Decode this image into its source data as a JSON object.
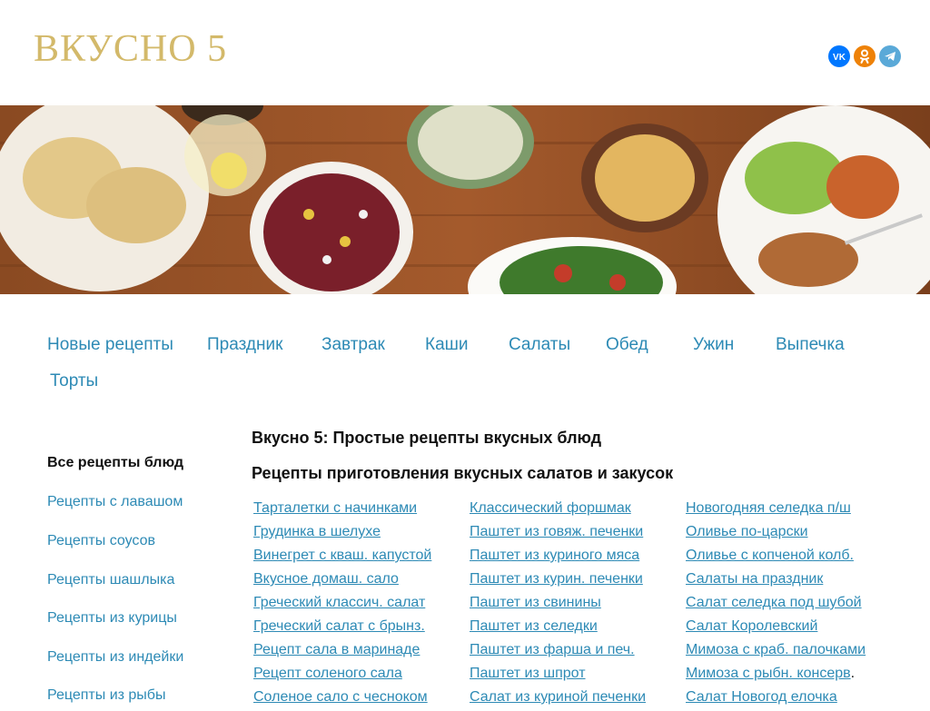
{
  "header": {
    "logo": "ВКУСНО 5",
    "social": [
      "vk-icon",
      "ok-icon",
      "telegram-icon"
    ]
  },
  "banner": {
    "image": "food-banner-photo"
  },
  "menu": [
    "Новые рецепты",
    "Праздник",
    "Завтрак",
    "Каши",
    "Салаты",
    "Обед",
    "Ужин",
    "Выпечка",
    "Торты"
  ],
  "sidebar": {
    "title": "Все рецепты блюд",
    "items": [
      "Рецепты с лавашом",
      "Рецепты соусов",
      "Рецепты шашлыка",
      "Рецепты из курицы",
      "Рецепты из индейки",
      "Рецепты из рыбы"
    ]
  },
  "main": {
    "title": "Вкусно 5: Простые рецепты вкусных блюд",
    "subtitle": "Рецепты приготовления вкусных салатов и закусок",
    "columns": [
      [
        "Тарталетки с начинками",
        "Грудинка в шелухе",
        "Винегрет с кваш. капустой",
        "Вкусное домаш. сало",
        "Греческий классич. салат",
        "Греческий салат с брынз.",
        "Рецепт сала в маринаде",
        "Рецепт соленого сала",
        "Соленое сало с чесноком"
      ],
      [
        "Классический форшмак",
        "Паштет из говяж. печенки",
        "Паштет из куриного мяса",
        "Паштет из курин. печенки",
        "Паштет из свинины",
        "Паштет из селедки",
        "Паштет из фарша и печ.",
        "Паштет из шпрот",
        "Салат из куриной печенки"
      ],
      [
        "Новогодняя селедка п/ш",
        "Оливье по-царски",
        "Оливье с копченой колб.",
        "Салаты на праздник",
        "Салат селедка под шубой",
        "Салат Королевский",
        "Мимоза с краб. палочками",
        "Мимоза с рыбн. консерв",
        "Салат Новогод елочка"
      ]
    ],
    "trailing_dot": "."
  },
  "colors": {
    "link": "#2d8ab5",
    "logo": "#d3b96a",
    "text": "#111111"
  }
}
